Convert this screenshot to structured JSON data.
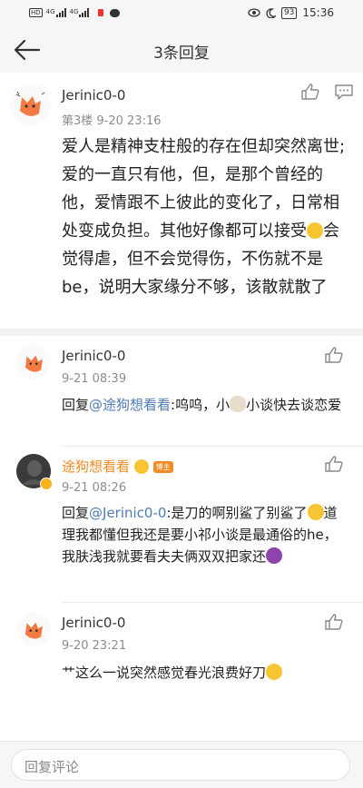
{
  "status_bar": {
    "left_icons": [
      "HD",
      "4G",
      "4G"
    ],
    "battery": "93",
    "time": "15:36"
  },
  "header": {
    "title": "3条回复"
  },
  "main_comment": {
    "username": "Jerinic0-0",
    "meta": "第3楼  9-20 23:16",
    "text_part1": "爱人是精神支柱般的存在但却突然离世;爱的一直只有他，但，是那个曾经的他，爱情跟不上彼此的变化了，日常相处变成负担。其他好像都可以接受",
    "text_part2": "会觉得虐，但不会觉得伤，不伤就不是be，说明大家缘分不够，该散就散了"
  },
  "replies": [
    {
      "username": "Jerinic0-0",
      "time": "9-21 08:39",
      "prefix": "回复",
      "mention": "@途狗想看看",
      "text_a": ":呜呜，小",
      "text_b": "小谈快去谈恋爱"
    },
    {
      "username": "途狗想看看",
      "badge": "博主",
      "time": "9-21 08:26",
      "prefix": "回复",
      "mention": "@Jerinic0-0",
      "text_a": ":是刀的啊别鲨了别鲨了",
      "text_b": "道理我都懂但我还是要小祁小谈是最通俗的he，我肤浅我就要看夫夫俩双双把家还"
    },
    {
      "username": "Jerinic0-0",
      "time": "9-20 23:21",
      "text_a": "艹这么一说突然感觉春光浪费好刀"
    }
  ],
  "bottom": {
    "placeholder": "回复评论"
  },
  "colors": {
    "mention": "#4e7bb4",
    "orange_name": "#f28b24",
    "avatar_fox": "#f47a44"
  }
}
